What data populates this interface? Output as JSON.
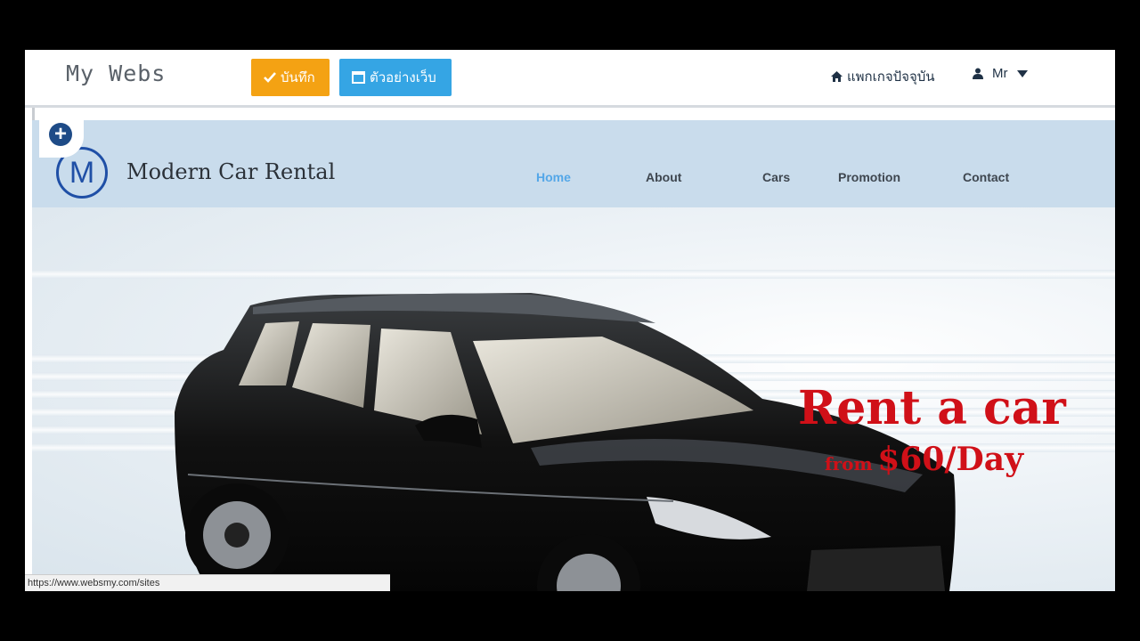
{
  "topbar": {
    "brand": "My Webs",
    "save_label": "บันทึก",
    "preview_label": "ตัวอย่างเว็บ",
    "current_package_label": "แพกเกจปัจจุบัน",
    "user_name": "Mr"
  },
  "site": {
    "logo_letter": "M",
    "title": "Modern Car Rental",
    "menu": [
      {
        "label": "Home",
        "active": true
      },
      {
        "label": "About",
        "active": false
      },
      {
        "label": "Cars",
        "active": false
      },
      {
        "label": "Promotion",
        "active": false
      },
      {
        "label": "Contact",
        "active": false
      }
    ],
    "hero": {
      "headline": "Rent a car",
      "from_label": "from",
      "price": "$60/Day"
    }
  },
  "statusbar": {
    "url": "https://www.websmy.com/sites"
  },
  "colors": {
    "save": "#f4a213",
    "preview": "#35a5e4",
    "headline": "#d01018",
    "header_bg": "#c9dcec",
    "active_menu": "#54a7e8"
  }
}
